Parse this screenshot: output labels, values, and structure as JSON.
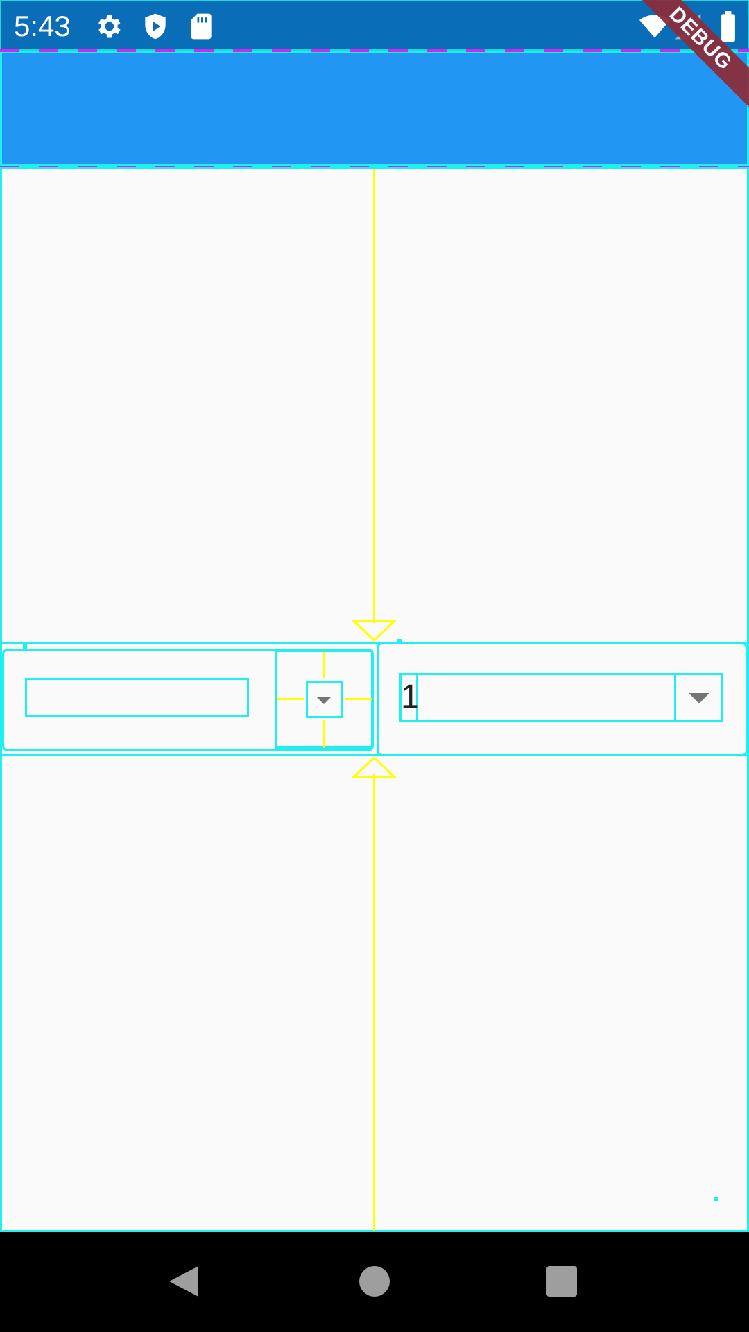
{
  "status_bar": {
    "time": "5:43",
    "icons": [
      "gear-icon",
      "shield-play-icon",
      "sd-card-icon",
      "wifi-icon",
      "signal-icon",
      "battery-icon"
    ]
  },
  "debug_banner": {
    "label": "DEBUG"
  },
  "dropdowns": {
    "left": {
      "value": ""
    },
    "right": {
      "value": "1"
    }
  },
  "colors": {
    "status_bar": "#0a6db8",
    "app_bar": "#2196f3",
    "debug_outline": "#1ef0f0",
    "debug_guide": "#ffff00",
    "debug_baseline": "#c42cf0",
    "background": "#fafafa"
  },
  "nav_bar": {
    "icons": [
      "back-icon",
      "home-icon",
      "recents-icon"
    ]
  }
}
